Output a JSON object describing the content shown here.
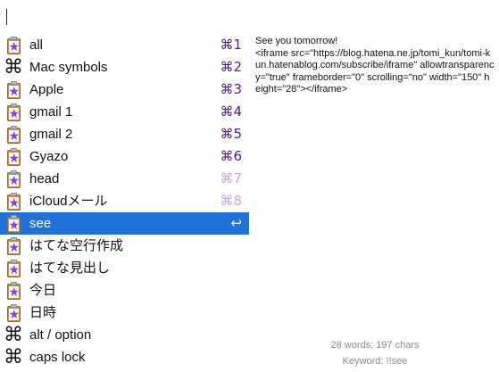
{
  "search": {
    "value": ""
  },
  "items": [
    {
      "icon": "clipboard-star-icon",
      "label": "all",
      "shortcut": "⌘1",
      "faded": false,
      "selected": false
    },
    {
      "icon": "command-icon",
      "label": "Mac symbols",
      "shortcut": "⌘2",
      "faded": false,
      "selected": false
    },
    {
      "icon": "clipboard-star-icon",
      "label": "Apple",
      "shortcut": "⌘3",
      "faded": false,
      "selected": false
    },
    {
      "icon": "clipboard-star-icon",
      "label": "gmail 1",
      "shortcut": "⌘4",
      "faded": false,
      "selected": false
    },
    {
      "icon": "clipboard-star-icon",
      "label": "gmail 2",
      "shortcut": "⌘5",
      "faded": false,
      "selected": false
    },
    {
      "icon": "clipboard-star-icon",
      "label": "Gyazo",
      "shortcut": "⌘6",
      "faded": false,
      "selected": false
    },
    {
      "icon": "clipboard-star-icon",
      "label": "head",
      "shortcut": "⌘7",
      "faded": true,
      "selected": false
    },
    {
      "icon": "clipboard-star-icon",
      "label": "iCloudメール",
      "shortcut": "⌘8",
      "faded": true,
      "selected": false
    },
    {
      "icon": "clipboard-star-icon",
      "label": "see",
      "shortcut": "↩",
      "faded": false,
      "selected": true
    },
    {
      "icon": "clipboard-star-icon",
      "label": "はてな空行作成",
      "shortcut": "",
      "faded": false,
      "selected": false
    },
    {
      "icon": "clipboard-star-icon",
      "label": "はてな見出し",
      "shortcut": "",
      "faded": false,
      "selected": false
    },
    {
      "icon": "clipboard-star-icon",
      "label": "今日",
      "shortcut": "",
      "faded": false,
      "selected": false
    },
    {
      "icon": "clipboard-star-icon",
      "label": "日時",
      "shortcut": "",
      "faded": false,
      "selected": false
    },
    {
      "icon": "command-icon",
      "label": "alt / option",
      "shortcut": "",
      "faded": false,
      "selected": false
    },
    {
      "icon": "command-icon",
      "label": "caps lock",
      "shortcut": "",
      "faded": false,
      "selected": false
    }
  ],
  "preview": {
    "text": "See you tomorrow!\n<iframe src=\"https://blog.hatena.ne.jp/tomi_kun/tomi-kun.hatenablog.com/subscribe/iframe\" allowtransparency=\"true\" frameborder=\"0\" scrolling=\"no\" width=\"150\" height=\"28\"></iframe>",
    "stats": "28 words; 197 chars",
    "keyword": "Keyword: !!see"
  },
  "colors": {
    "selection": "#1f72d8",
    "shortcut": "#5a1a7a",
    "shortcut_faded": "#c9a6dc",
    "star": "#8e3fc8"
  }
}
